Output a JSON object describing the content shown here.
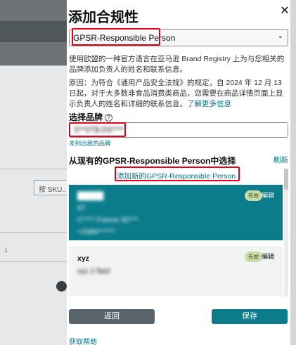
{
  "background": {
    "sku_placeholder": "按 SKU..."
  },
  "modal": {
    "title": "添加合规性",
    "close_icon": "close-icon",
    "select_value": "GPSR-Responsible Person",
    "description": "使用欧盟的一种官方语言在亚马逊 Brand Registry 上为与您相关的品牌添加负责人的姓名和联系信息。",
    "reason_text": "原因：为符合《通用产品安全法规》的规定，自 2024 年 12 月 13 日起，对于大多数非食品消费类商品，您需要在商品详情页面上显示负责人的姓名和详细的联系信息。",
    "learn_more": "了解更多信息",
    "brand_label": "选择品牌",
    "brand_value": "S**ST$ DS****",
    "unlisted_brand": "未列出我的品牌",
    "section_title": "从现有的GPSR-Responsible Person中选择",
    "refresh": "刷新",
    "add_new": "添加新的GPSR-Responsible Person",
    "persons": [
      {
        "name": "",
        "line1": "67",
        "line2": "C**** France 92***",
        "line3": "+3380******",
        "badge": "有效",
        "edit": "编辑"
      },
      {
        "name": "xyz",
        "line1": "xyz 2 flat2",
        "badge": "有效",
        "edit": "编辑"
      }
    ],
    "back_button": "返回",
    "save_button": "保存",
    "help": "获取帮助"
  },
  "colors": {
    "accent": "#0a7c8c",
    "link": "#007185",
    "highlight": "#e4001b"
  }
}
